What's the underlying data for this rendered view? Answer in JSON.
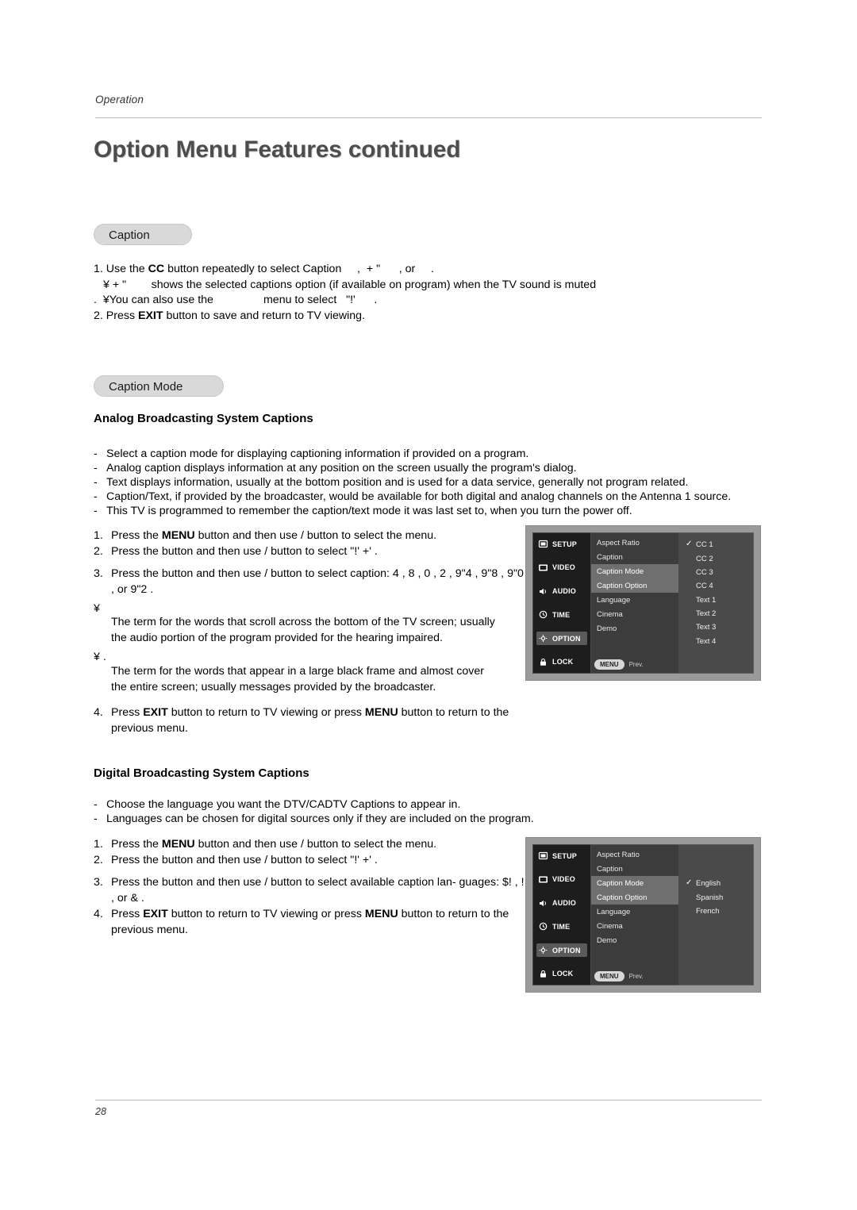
{
  "header": {
    "section_label": "Operation",
    "title": "Option Menu Features continued"
  },
  "sections": {
    "caption": {
      "pill_label": "Caption",
      "items": [
        "1. Use the CC button repeatedly to select Caption     ,  + \"      , or     .",
        "¥ + \"        shows the selected captions option (if available on program) when the TV sound is muted",
        ".  ¥You can also use the                menu to select   \"!'      .",
        "2. Press EXIT button to save and return to TV viewing."
      ]
    },
    "caption_mode": {
      "pill_label": "Caption Mode",
      "analog": {
        "heading": "Analog Broadcasting System Captions",
        "bullets": [
          "Select a caption mode for displaying captioning information if provided on a program.",
          "Analog caption displays information at any position on the screen usually the program's dialog.",
          "Text displays information, usually at the bottom position and is used for a data service, generally not program related.",
          "Caption/Text, if provided by the broadcaster, would be available for both digital and analog channels on the Antenna 1 source.",
          "This TV is programmed to remember the caption/text mode it was last set to, when you turn the power off."
        ],
        "steps": [
          {
            "n": "1.",
            "text": "Press the MENU button and then use      /      button to select the                menu."
          },
          {
            "n": "2.",
            "text": "Press the       button and then use      /     button to select   \"!'  +'          ."
          },
          {
            "n": "3.",
            "text": "Press the       button and then use      /      button to select caption:   4    ,   8    ,   0    ,\n2    ,   9\"4   ,   9\"8   ,   9\"0    , or  9\"2   ."
          }
        ],
        "notes": [
          {
            "marker": "¥",
            "text": "The term for the words that scroll across the bottom of the TV screen; usually\nthe audio portion of the program provided for the hearing impaired."
          },
          {
            "marker": "¥ .",
            "text": "The term for the words that appear in a large black frame and almost cover\nthe entire screen; usually messages provided by the broadcaster."
          }
        ],
        "step4": {
          "n": "4.",
          "text": "Press EXIT button to return to TV viewing or press MENU button to return to the\nprevious menu."
        }
      },
      "digital": {
        "heading": "Digital Broadcasting System Captions",
        "bullets": [
          "Choose the language you want the DTV/CADTV Captions to appear in.",
          "Languages can be chosen for digital sources only if they are included on the program."
        ],
        "steps": [
          {
            "n": "1.",
            "text": "Press the MENU button and then use      /      button to select the                menu."
          },
          {
            "n": "2.",
            "text": "Press the       button and then use      /     button to select   \"!'  +'          ."
          },
          {
            "n": "3.",
            "text": "Press the        button and then use      /      button to select available caption lan-\nguages:    $!      ,    !        , or  &         ."
          },
          {
            "n": "4.",
            "text": "Press EXIT button to return to TV viewing or press MENU button to return to the\nprevious menu."
          }
        ]
      }
    }
  },
  "osd_analog": {
    "left_buttons": [
      {
        "label": "SETUP",
        "icon": "setup-icon",
        "selected": false
      },
      {
        "label": "VIDEO",
        "icon": "video-icon",
        "selected": false
      },
      {
        "label": "AUDIO",
        "icon": "audio-icon",
        "selected": false
      },
      {
        "label": "TIME",
        "icon": "clock-icon",
        "selected": false
      },
      {
        "label": "OPTION",
        "icon": "option-icon",
        "selected": true
      },
      {
        "label": "LOCK",
        "icon": "lock-icon",
        "selected": false
      }
    ],
    "menu_items": [
      {
        "label": "Aspect Ratio",
        "highlight": false
      },
      {
        "label": "Caption",
        "highlight": false
      },
      {
        "label": "Caption Mode",
        "highlight": true
      },
      {
        "label": "Caption Option",
        "highlight": false
      },
      {
        "label": "Language",
        "highlight": false
      },
      {
        "label": "Cinema",
        "highlight": false
      },
      {
        "label": "Demo",
        "highlight": false
      }
    ],
    "menu_bar": {
      "button": "MENU",
      "hint": "Prev."
    },
    "options": [
      {
        "label": "CC 1",
        "checked": true
      },
      {
        "label": "CC 2",
        "checked": false
      },
      {
        "label": "CC 3",
        "checked": false
      },
      {
        "label": "CC 4",
        "checked": false
      },
      {
        "label": "Text 1",
        "checked": false
      },
      {
        "label": "Text 2",
        "checked": false
      },
      {
        "label": "Text 3",
        "checked": false
      },
      {
        "label": "Text 4",
        "checked": false
      }
    ]
  },
  "osd_digital": {
    "left_buttons": [
      {
        "label": "SETUP",
        "icon": "setup-icon",
        "selected": false
      },
      {
        "label": "VIDEO",
        "icon": "video-icon",
        "selected": false
      },
      {
        "label": "AUDIO",
        "icon": "audio-icon",
        "selected": false
      },
      {
        "label": "TIME",
        "icon": "clock-icon",
        "selected": false
      },
      {
        "label": "OPTION",
        "icon": "option-icon",
        "selected": true
      },
      {
        "label": "LOCK",
        "icon": "lock-icon",
        "selected": false
      }
    ],
    "menu_items": [
      {
        "label": "Aspect Ratio",
        "highlight": false
      },
      {
        "label": "Caption",
        "highlight": false
      },
      {
        "label": "Caption Mode",
        "highlight": true
      },
      {
        "label": "Caption Option",
        "highlight": true
      },
      {
        "label": "Language",
        "highlight": false
      },
      {
        "label": "Cinema",
        "highlight": false
      },
      {
        "label": "Demo",
        "highlight": false
      }
    ],
    "menu_bar": {
      "button": "MENU",
      "hint": "Prev."
    },
    "options": [
      {
        "label": "English",
        "checked": true
      },
      {
        "label": "Spanish",
        "checked": false
      },
      {
        "label": "French",
        "checked": false
      }
    ]
  },
  "footer": {
    "page_number": "28"
  }
}
